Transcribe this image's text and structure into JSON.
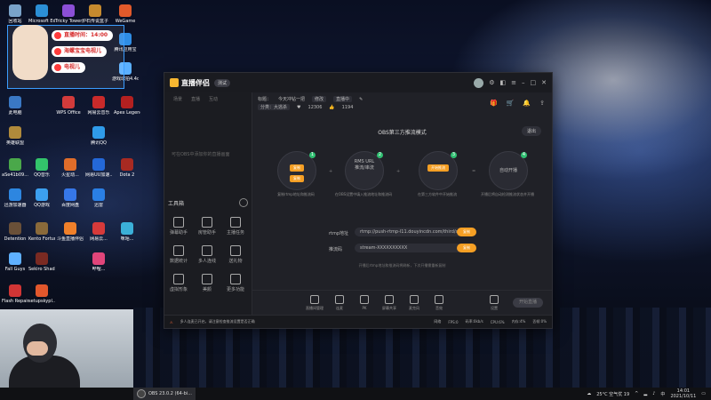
{
  "desktop": {
    "icons_col1": [
      "回收站",
      "Microsoft Edge",
      "Tricky Towers",
      "炉石传说盒子",
      "WeGame",
      "Apex Legends",
      "此电脑",
      "英雄联盟",
      "aSe41b09...",
      "迅游加速器",
      "Detention",
      "Fall Guys",
      "Flash Repair"
    ],
    "icons_col2": [
      "QQ音乐",
      "WPS Office",
      "网易云音乐",
      "腾讯QQ",
      "迅雷",
      "QQ游戏",
      "Kento Fortune ...",
      "Sekiro Shadow...",
      "setupskypl..."
    ],
    "icons_col3": [
      "火星动...",
      "网易UU加速...",
      "百度网盘",
      "Dota 2",
      "斗鱼直播伴侣",
      "网易云...",
      "哔哩...",
      "咪咕..."
    ],
    "icons_top_right": [
      "游戏球拍4.4d",
      "腾讯应用宝"
    ]
  },
  "overlay": {
    "pill1": "直播时间：14:00",
    "pill2": "海螺宝宝电视儿",
    "pill3": "电视儿"
  },
  "app": {
    "name": "直播伴侣",
    "beta_badge": "测试",
    "sidebar_tabs": [
      "场景",
      "直播",
      "互动"
    ],
    "sidebar_empty_hint": "可在OBS中添加你的直播画面",
    "tools_title": "工具箱",
    "tools": [
      {
        "label": "弹幕助手"
      },
      {
        "label": "房管助手"
      },
      {
        "label": "主播任务"
      },
      {
        "label": "数据统计"
      },
      {
        "label": "多人连线"
      },
      {
        "label": "送礼物"
      },
      {
        "label": "虚拟形象"
      },
      {
        "label": "美颜"
      },
      {
        "label": "更多功能"
      }
    ],
    "info": {
      "title_label": "标题：",
      "title_value": "今天冲钻一把",
      "edit": "修改",
      "status": "直播中",
      "category_label": "分类：",
      "category_value": "大逃杀",
      "fans": "12306",
      "likes": "1194"
    },
    "mode_title": "OBS第三方推流模式",
    "exit_label": "退出",
    "steps": [
      {
        "num": "1",
        "line1": "复制",
        "line2": "复制",
        "desc": "复制rtmp地址和推流码"
      },
      {
        "num": "2",
        "line1": "RMS URL",
        "line2": "推流/串流",
        "desc": "在OBS设置中填入推流地址和推流码"
      },
      {
        "num": "3",
        "line1": "开始推流",
        "line2": "",
        "desc": "在第三方软件中开始推流"
      },
      {
        "num": "4",
        "line1": "自动开播",
        "line2": "",
        "desc": "开播后将自动检测推流状态并开播"
      }
    ],
    "rtmp_label": "rtmp地址",
    "rtmp_value": "rtmp://push-rtmp-l11.douyincdn.com/third/stream",
    "key_label": "推流码",
    "key_value": "stream-XXXXXXXXXX",
    "copy_btn": "复制",
    "hint": "开播后rtmp地址和推流码将刷新，下次开播需重新复制",
    "bottom_tools": [
      "直播间管理",
      "连麦",
      "PK",
      "屏幕共享",
      "麦克风",
      "音效",
      "设置"
    ],
    "start_button": "开始直播",
    "status_bar": {
      "warning": "多人连麦已开启，请注意检查推流设置是否正确",
      "network": "网络",
      "fps": "FPS:0",
      "bitrate": "码率:0kb/s",
      "cpu": "CPU:6%",
      "mem": "内存:4%",
      "drop": "丢帧:0%"
    }
  },
  "taskbar": {
    "app": "OBS 23.0.2 (64-bi...",
    "weather": "25°C 空气优 19",
    "time": "14:01",
    "date": "2021/10/11"
  },
  "colors": {
    "accent": "#f59f24",
    "step_num": "#2fbf71",
    "warn": "#ff6b3d"
  }
}
